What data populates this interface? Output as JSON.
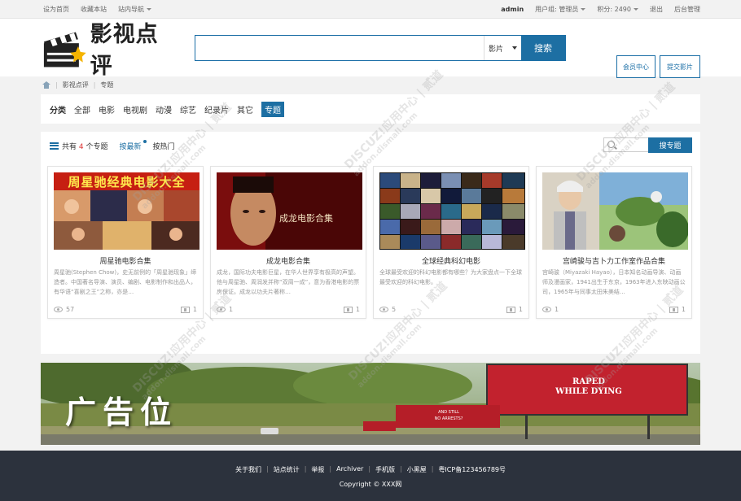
{
  "topbar": {
    "set_home": "设为首页",
    "bookmark": "收藏本站",
    "site_nav": "站内导航",
    "username": "admin",
    "user_group": "用户组: 管理员",
    "points": "积分: 2490",
    "logout": "退出",
    "admin_panel": "后台管理"
  },
  "header": {
    "logo_text": "影视点评",
    "search_placeholder": "",
    "search_scope": "影片",
    "search_button": "搜索",
    "member_center": "会员中心",
    "submit_movie": "提交影片"
  },
  "breadcrumb": [
    "影视点评",
    "专题"
  ],
  "categories": {
    "label": "分类",
    "items": [
      "全部",
      "电影",
      "电视剧",
      "动漫",
      "综艺",
      "纪录片",
      "其它",
      "专题"
    ],
    "active": "专题"
  },
  "panel": {
    "count_prefix": "共有",
    "count": "4",
    "count_suffix": "个专题",
    "sort_latest": "按最新",
    "sort_hot": "按热门",
    "topic_search_button": "搜专题"
  },
  "cards": [
    {
      "title": "周星驰电影合集",
      "poster_text": "周星驰经典电影大全",
      "desc": "周星驰(Stephen Chow)，史无前例的「周星驰现象」缔造者。中国著名导演、演员、编剧、电影制作和出品人，有华语“喜剧之王”之称，亦是…",
      "views": "57",
      "movies": "1"
    },
    {
      "title": "成龙电影合集",
      "poster_text": "成龙电影合集",
      "desc": "成龙，国际功夫电影巨星，在华人世界享有极高的声望。他与周星驰、周润发并称“双周一成”，意为香港电影的票房保证。成龙以功夫片著称…",
      "views": "1",
      "movies": "1"
    },
    {
      "title": "全球经典科幻电影",
      "poster_text": "",
      "desc": "全球最受欢迎的科幻电影都有哪些？为大家盘点一下全球最受欢迎的科幻电影。",
      "views": "5",
      "movies": "1"
    },
    {
      "title": "宫崎骏与吉卜力工作室作品合集",
      "poster_text": "",
      "desc": "宫崎骏（Miyazaki Hayao），日本知名动画导演、动画师及漫画家，1941出生于东京，1963年进入东映动画公司，1965年与同事太田朱美结…",
      "views": "1",
      "movies": "1"
    }
  ],
  "banner": {
    "text": "广告位",
    "sign_line1": "RAPED",
    "sign_line2": "WHILE DYING",
    "sign2_line1": "AND STILL",
    "sign2_line2": "NO ARRESTS?"
  },
  "footer": {
    "links": [
      "关于我们",
      "站点统计",
      "举报",
      "Archiver",
      "手机版",
      "小黑屋",
      "粤ICP备123456789号"
    ],
    "copyright": "Copyright © XXX网"
  },
  "watermark": {
    "line1": "DISCUZ!应用中心 | 贰道",
    "line2": "addon.dismall.com"
  },
  "colors": {
    "primary": "#1d6fa3",
    "footer_bg": "#2c323d",
    "count_red": "#dd3333"
  }
}
